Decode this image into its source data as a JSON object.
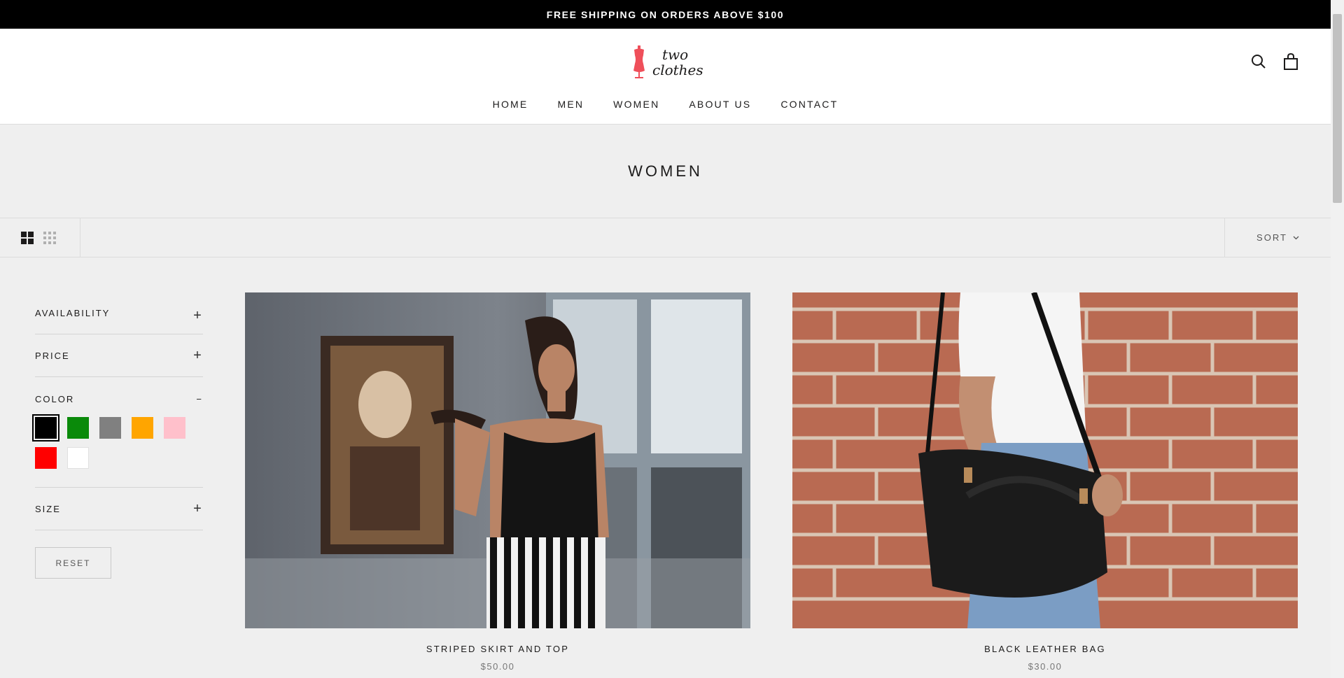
{
  "announcement": "FREE SHIPPING ON ORDERS ABOVE $100",
  "logo": {
    "line1": "two",
    "line2": "clothes",
    "mark_color": "#ef4f5a"
  },
  "nav": [
    "HOME",
    "MEN",
    "WOMEN",
    "ABOUT US",
    "CONTACT"
  ],
  "page_title": "WOMEN",
  "toolbar": {
    "sort_label": "SORT"
  },
  "filters": {
    "availability": "AVAILABILITY",
    "price": "PRICE",
    "color": "COLOR",
    "size": "SIZE",
    "collapsed_sign": "+",
    "expanded_sign": "−",
    "swatches": [
      {
        "name": "black",
        "hex": "#000000",
        "selected": true
      },
      {
        "name": "green",
        "hex": "#0a8a0a",
        "selected": false
      },
      {
        "name": "gray",
        "hex": "#808080",
        "selected": false
      },
      {
        "name": "orange",
        "hex": "#ffa500",
        "selected": false
      },
      {
        "name": "pink",
        "hex": "#ffc0cb",
        "selected": false
      },
      {
        "name": "red",
        "hex": "#ff0000",
        "selected": false
      },
      {
        "name": "white",
        "hex": "#ffffff",
        "selected": false
      }
    ],
    "reset_label": "RESET"
  },
  "products": [
    {
      "name": "STRIPED SKIRT AND TOP",
      "price": "$50.00"
    },
    {
      "name": "BLACK LEATHER BAG",
      "price": "$30.00"
    }
  ]
}
